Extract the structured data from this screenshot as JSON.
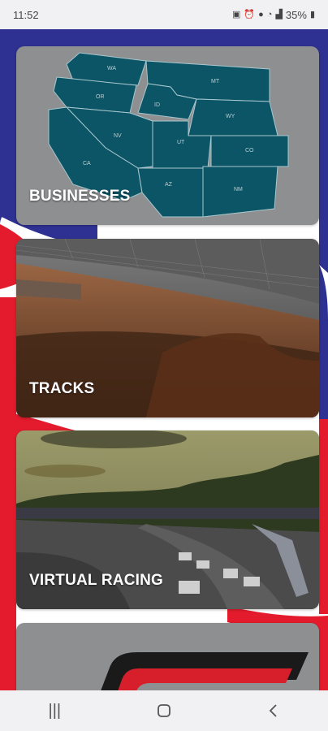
{
  "status": {
    "time": "11:52",
    "battery": "35%",
    "icons": [
      "sim-icon",
      "alarm-icon",
      "location-icon",
      "wifi-icon",
      "signal-icon",
      "battery-icon"
    ]
  },
  "cards": [
    {
      "label": "BUSINESSES",
      "image": "western-us-map",
      "states": [
        "WA",
        "MT",
        "OR",
        "ID",
        "WY",
        "NV",
        "UT",
        "CO",
        "CA",
        "AZ",
        "NM"
      ]
    },
    {
      "label": "TRACKS",
      "image": "dirt-track-photo"
    },
    {
      "label": "VIRTUAL RACING",
      "image": "virtual-race-photo"
    },
    {
      "label": "",
      "image": "logo-partial"
    }
  ],
  "colors": {
    "brand_blue": "#2e3192",
    "brand_red": "#e31b2d",
    "map_teal": "#0b5566",
    "card_gray": "#8e8f91"
  },
  "nav": {
    "icons": [
      "recents-icon",
      "home-icon",
      "back-icon"
    ]
  }
}
